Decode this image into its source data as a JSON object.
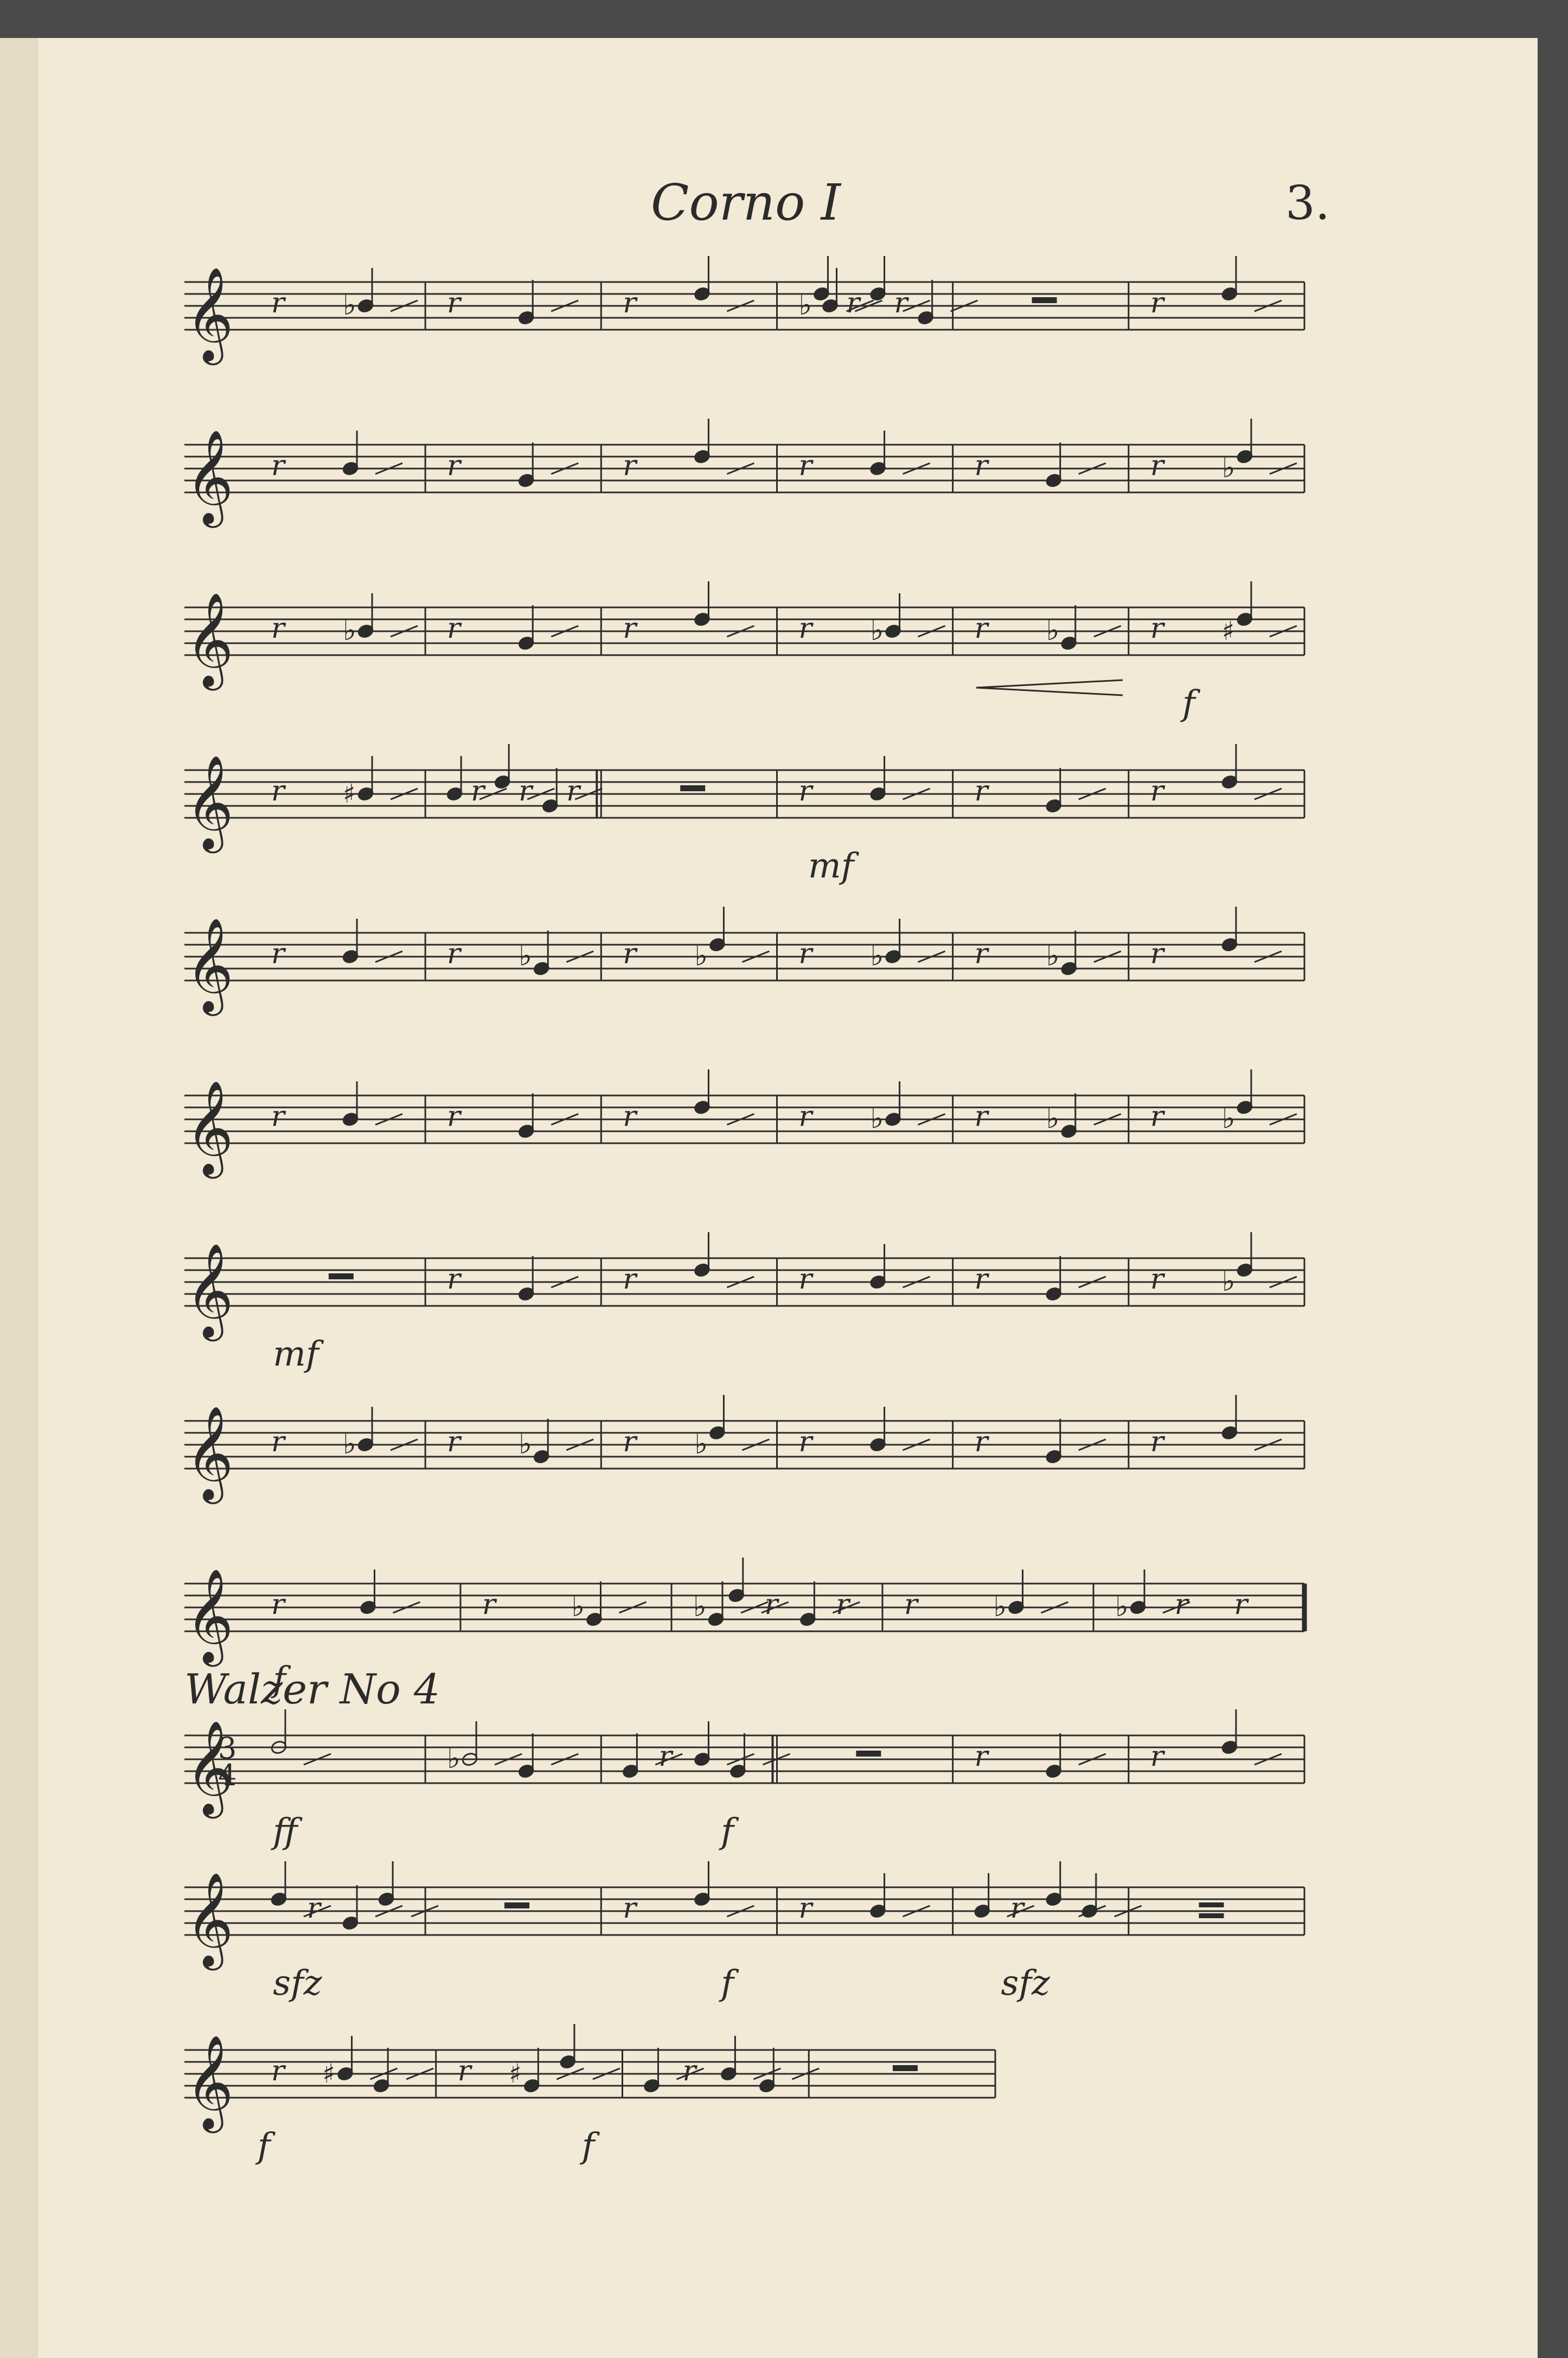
{
  "header": {
    "title": "Corno I",
    "page_number": "3."
  },
  "section": {
    "heading": "Walzer No 4",
    "time_signature": {
      "top": "3",
      "bottom": "4"
    }
  },
  "dynamics": {
    "f": "f",
    "mf": "mf",
    "ff": "ff",
    "sfz": "sfz"
  },
  "staves": [
    {
      "id": 1,
      "bars": [
        "r bn",
        "r n",
        "r n",
        "b n r n r n",
        "rest",
        "r n"
      ]
    },
    {
      "id": 2,
      "bars": [
        "r n",
        "r n",
        "r n",
        "r n",
        "r n",
        "r bn"
      ]
    },
    {
      "id": 3,
      "bars": [
        "r bn",
        "r n",
        "r n",
        "r bn",
        "r bn",
        "r #n"
      ],
      "dynamic": "f",
      "hairpin": true
    },
    {
      "id": 4,
      "bars": [
        "r #n",
        "n r n r n r",
        "rest",
        "r n",
        "r n",
        "r n"
      ],
      "dynamic": "mf",
      "double_bar": true
    },
    {
      "id": 5,
      "bars": [
        "r n",
        "r bn",
        "r bn",
        "r bn",
        "r bn",
        "r n"
      ]
    },
    {
      "id": 6,
      "bars": [
        "r n",
        "r n",
        "r n",
        "r bn",
        "r bn",
        "r bn"
      ]
    },
    {
      "id": 7,
      "bars": [
        "rest",
        "r n",
        "r n",
        "r n",
        "r n",
        "r bn"
      ],
      "dynamic": "mf"
    },
    {
      "id": 8,
      "bars": [
        "r bn",
        "r bn",
        "r bn",
        "r n",
        "r n",
        "r n"
      ]
    },
    {
      "id": 9,
      "bars": [
        "r n",
        "r bn",
        "bn n r n r",
        "r bn",
        "bn r r"
      ],
      "dynamic": "f",
      "final_bar": true
    },
    {
      "id": 10,
      "bars": [
        "h.",
        "bh n",
        "n r n n",
        "rest",
        "r n",
        "r n"
      ],
      "dynamics": [
        "ff",
        "f"
      ],
      "time_signature": true,
      "double_bar": true
    },
    {
      "id": 11,
      "bars": [
        "n r n n",
        "rest",
        "r n",
        "r n",
        "n r n n",
        "rest2"
      ],
      "dynamics": [
        "sfz",
        "f",
        "sfz"
      ]
    },
    {
      "id": 12,
      "bars": [
        "r #n n",
        "r #n n",
        "n r n n",
        "rest"
      ],
      "dynamics": [
        "f",
        "f"
      ],
      "short": true
    }
  ],
  "colors": {
    "paper": "#f2e9d6",
    "ink": "#2b2b2b",
    "background": "#4a4a4a"
  }
}
